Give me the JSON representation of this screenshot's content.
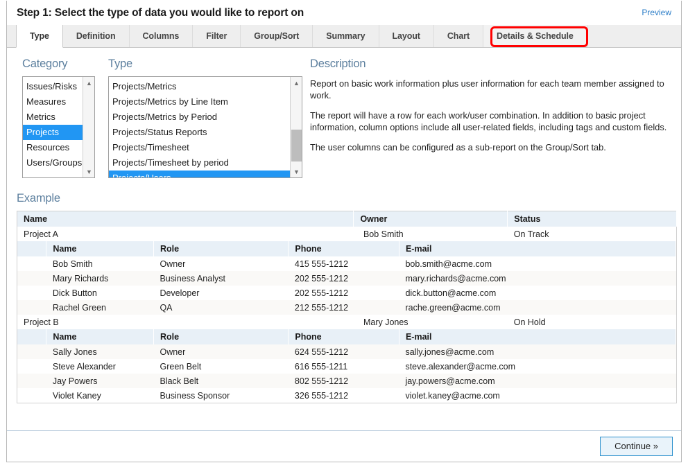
{
  "header": {
    "step_title": "Step 1: Select the type of data you would like to report on",
    "preview_label": "Preview",
    "link_color": "#2a7cc7"
  },
  "tabs": {
    "items": [
      {
        "label": "Type",
        "active": true,
        "highlighted": false
      },
      {
        "label": "Definition",
        "active": false,
        "highlighted": false
      },
      {
        "label": "Columns",
        "active": false,
        "highlighted": false
      },
      {
        "label": "Filter",
        "active": false,
        "highlighted": false
      },
      {
        "label": "Group/Sort",
        "active": false,
        "highlighted": false
      },
      {
        "label": "Summary",
        "active": false,
        "highlighted": false
      },
      {
        "label": "Layout",
        "active": false,
        "highlighted": false
      },
      {
        "label": "Chart",
        "active": false,
        "highlighted": false
      },
      {
        "label": "Details & Schedule",
        "active": false,
        "highlighted": true
      }
    ],
    "highlight_color": "#ff0000"
  },
  "category": {
    "label": "Category",
    "options": [
      "Issues/Risks",
      "Measures",
      "Metrics",
      "Projects",
      "Resources",
      "Users/Groups"
    ],
    "selected": "Projects",
    "scroll_up_icon": "chevron-up-icon",
    "scroll_down_icon": "chevron-down-icon"
  },
  "type": {
    "label": "Type",
    "options": [
      "Projects/Metrics",
      "Projects/Metrics by Line Item",
      "Projects/Metrics by Period",
      "Projects/Status Reports",
      "Projects/Timesheet",
      "Projects/Timesheet by period",
      "Projects/Users"
    ],
    "selected": "Projects/Users",
    "scroll_up_icon": "chevron-up-icon",
    "scroll_down_icon": "chevron-down-icon"
  },
  "description": {
    "label": "Description",
    "paragraphs": [
      "Report on basic work information plus user information for each team member assigned to work.",
      "The report will have a row for each work/user combination. In addition to basic project information, column options include all user-related fields, including tags and custom fields.",
      "The user columns can be configured as a sub-report on the Group/Sort tab."
    ]
  },
  "example": {
    "label": "Example",
    "outer_columns": [
      "Name",
      "Owner",
      "Status"
    ],
    "sub_columns": [
      "Name",
      "Role",
      "Phone",
      "E-mail"
    ],
    "projects": [
      {
        "name": "Project A",
        "owner": "Bob Smith",
        "status": "On Track",
        "members": [
          {
            "name": "Bob Smith",
            "role": "Owner",
            "phone": "415 555-1212",
            "email": "bob.smith@acme.com"
          },
          {
            "name": "Mary Richards",
            "role": "Business Analyst",
            "phone": "202 555-1212",
            "email": "mary.richards@acme.com"
          },
          {
            "name": "Dick Button",
            "role": "Developer",
            "phone": "202 555-1212",
            "email": "dick.button@acme.com"
          },
          {
            "name": "Rachel Green",
            "role": "QA",
            "phone": "212 555-1212",
            "email": "rache.green@acme.com"
          }
        ]
      },
      {
        "name": "Project B",
        "owner": "Mary Jones",
        "status": "On Hold",
        "members": [
          {
            "name": "Sally Jones",
            "role": "Owner",
            "phone": "624 555-1212",
            "email": "sally.jones@acme.com"
          },
          {
            "name": "Steve Alexander",
            "role": "Green Belt",
            "phone": "616 555-1211",
            "email": "steve.alexander@acme.com"
          },
          {
            "name": "Jay Powers",
            "role": "Black Belt",
            "phone": "802 555-1212",
            "email": "jay.powers@acme.com"
          },
          {
            "name": "Violet Kaney",
            "role": "Business Sponsor",
            "phone": "326 555-1212",
            "email": "violet.kaney@acme.com"
          }
        ]
      }
    ]
  },
  "footer": {
    "continue_label": "Continue »"
  }
}
